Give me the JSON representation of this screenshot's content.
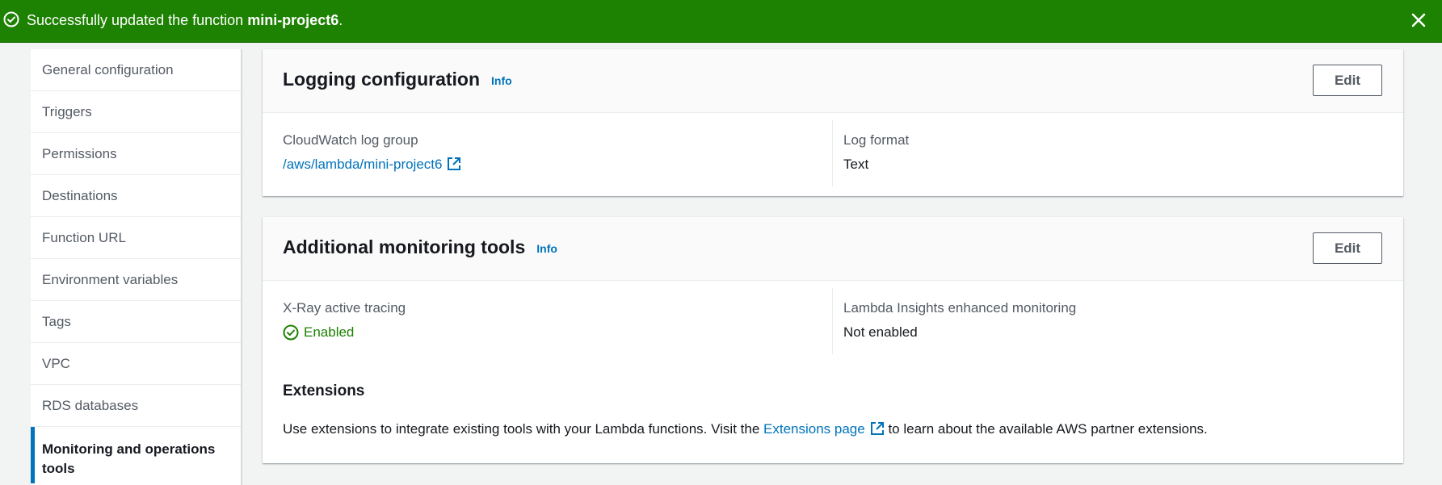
{
  "flash": {
    "message_prefix": "Successfully updated the function ",
    "function_name": "mini-project6",
    "message_suffix": ".",
    "color": "#1d8102"
  },
  "sidebar": {
    "items": [
      {
        "label": "General configuration"
      },
      {
        "label": "Triggers"
      },
      {
        "label": "Permissions"
      },
      {
        "label": "Destinations"
      },
      {
        "label": "Function URL"
      },
      {
        "label": "Environment variables"
      },
      {
        "label": "Tags"
      },
      {
        "label": "VPC"
      },
      {
        "label": "RDS databases"
      },
      {
        "label": "Monitoring and operations tools",
        "active": true
      }
    ]
  },
  "logging": {
    "title": "Logging configuration",
    "info": "Info",
    "edit": "Edit",
    "log_group_label": "CloudWatch log group",
    "log_group_value": "/aws/lambda/mini-project6",
    "log_format_label": "Log format",
    "log_format_value": "Text"
  },
  "monitoring": {
    "title": "Additional monitoring tools",
    "info": "Info",
    "edit": "Edit",
    "xray_label": "X-Ray active tracing",
    "xray_value": "Enabled",
    "insights_label": "Lambda Insights enhanced monitoring",
    "insights_value": "Not enabled",
    "extensions_title": "Extensions",
    "extensions_text_before": "Use extensions to integrate existing tools with your Lambda functions. Visit the ",
    "extensions_link": "Extensions page",
    "extensions_text_after": " to learn about the available AWS partner extensions."
  },
  "colors": {
    "accent_link": "#0073bb",
    "success": "#1d8102",
    "active_indicator": "#0073bb"
  }
}
